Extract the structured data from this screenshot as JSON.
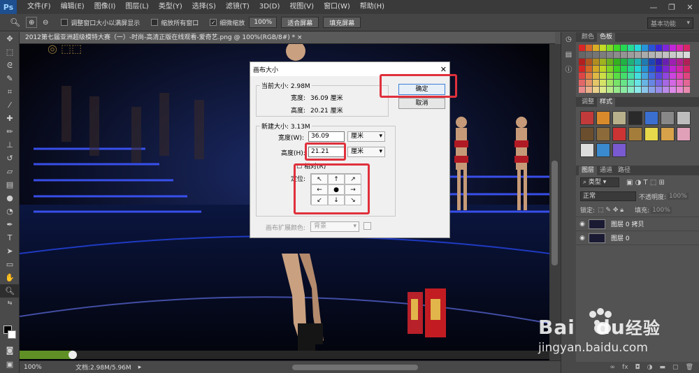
{
  "menu": {
    "logo": "Ps",
    "items": [
      "文件(F)",
      "编辑(E)",
      "图像(I)",
      "图层(L)",
      "类型(Y)",
      "选择(S)",
      "滤镜(T)",
      "3D(D)",
      "视图(V)",
      "窗口(W)",
      "帮助(H)"
    ]
  },
  "options": {
    "fit_window": "调整窗口大小以满屏显示",
    "zoom_all": "缩放所有窗口",
    "scrubby": "细微缩放",
    "btn_100": "100%",
    "btn_fit": "适合屏幕",
    "btn_fill": "填充屏幕",
    "workspace": "基本功能"
  },
  "doc": {
    "tab_title": "2012第七届亚洲超级模特大赛（一）-时尚-高清正版在线观看-爱奇艺.png @ 100%(RGB/8#) *  ×"
  },
  "status": {
    "zoom": "100%",
    "docinfo": "文档:2.98M/5.96M",
    "progress_fraction": 0.1
  },
  "panels": {
    "swatch_tabs": [
      "颜色",
      "色板"
    ],
    "style_tabs": [
      "调整",
      "样式"
    ],
    "layer_tabs": [
      "图层",
      "通道",
      "路径"
    ],
    "kind_label": "类型",
    "blend_mode": "正常",
    "opacity_label": "不透明度:",
    "opacity_value": "100%",
    "lock_label": "锁定:",
    "fill_label": "填充:",
    "fill_value": "100%",
    "layers": [
      {
        "name": "图层 0 拷贝"
      },
      {
        "name": "图层 0"
      }
    ]
  },
  "dialog": {
    "title": "画布大小",
    "current_group": "当前大小: 2.98M",
    "cur_width_label": "宽度:",
    "cur_width_value": "36.09 厘米",
    "cur_height_label": "高度:",
    "cur_height_value": "20.21 厘米",
    "new_group": "新建大小: 3.13M",
    "width_label": "宽度(W):",
    "width_value": "36.09",
    "width_unit": "厘米",
    "height_label": "高度(H):",
    "height_value": "21.21",
    "height_unit": "厘米",
    "relative_label": "相对(R)",
    "anchor_label": "定位:",
    "ext_color_label": "画布扩展颜色:",
    "ext_color_value": "背景",
    "ok": "确定",
    "cancel": "取消",
    "anchor_arrows": [
      "↖",
      "↑",
      "↗",
      "←",
      "●",
      "→",
      "↙",
      "↓",
      "↘"
    ]
  },
  "watermark": {
    "brand": "Bai",
    "brand2": "du",
    "suffix": "经验",
    "url": "jingyan.baidu.com"
  },
  "colors": {
    "highlight": "#e0303c",
    "accent": "#5f8f25"
  }
}
